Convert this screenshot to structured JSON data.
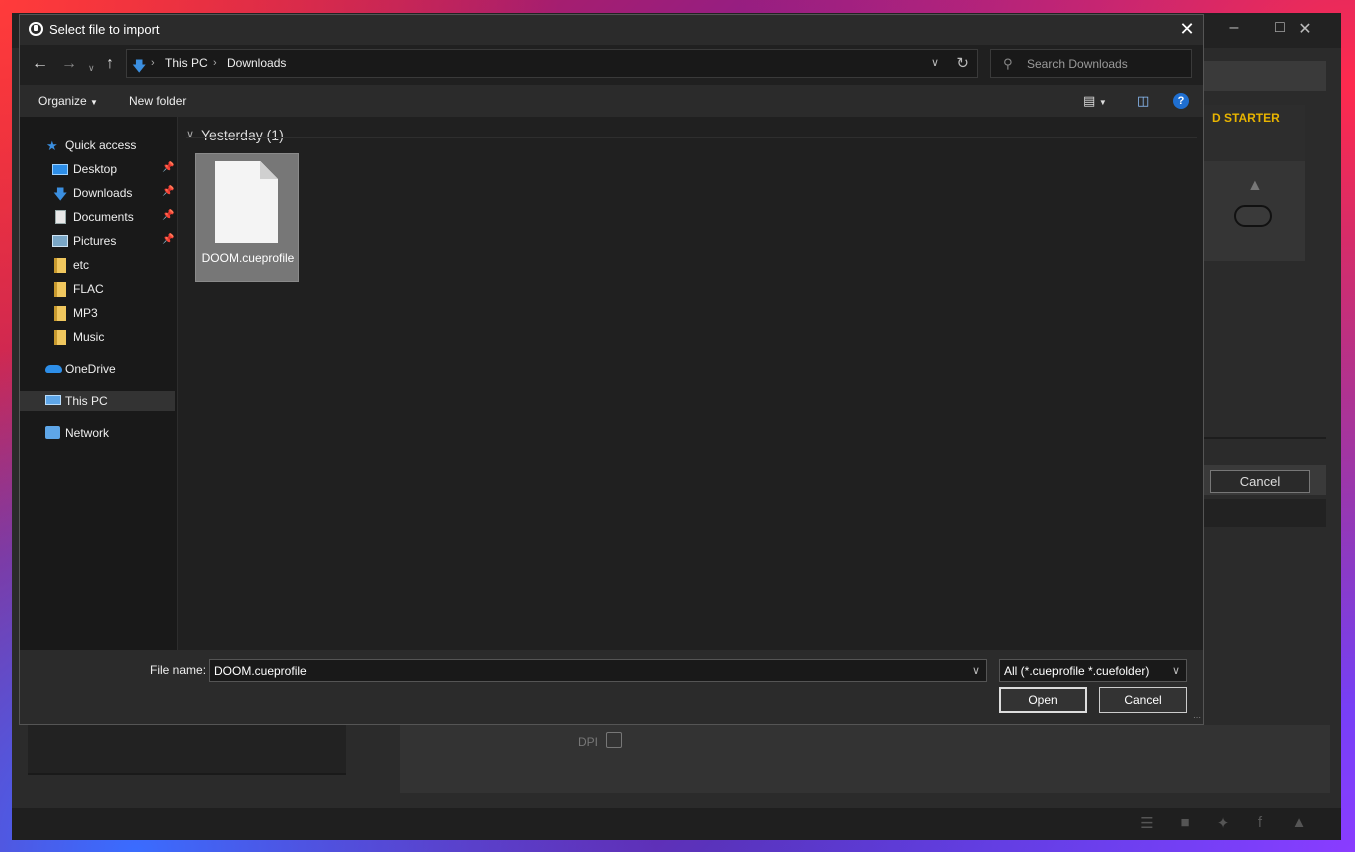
{
  "background_app": {
    "card_title": "D STARTER",
    "cancel_label": "Cancel",
    "dpi_label": "DPI"
  },
  "dialog": {
    "title": "Select file to import",
    "breadcrumb": [
      "This PC",
      "Downloads"
    ],
    "search_placeholder": "Search Downloads",
    "toolbar": {
      "organize_label": "Organize",
      "new_folder_label": "New folder"
    },
    "sidebar": {
      "quick_access": "Quick access",
      "items": [
        {
          "label": "Desktop",
          "icon": "desktop-icon",
          "pinned": true
        },
        {
          "label": "Downloads",
          "icon": "downloads-icon",
          "pinned": true
        },
        {
          "label": "Documents",
          "icon": "documents-icon",
          "pinned": true
        },
        {
          "label": "Pictures",
          "icon": "pictures-icon",
          "pinned": true
        },
        {
          "label": "etc",
          "icon": "folder-icon",
          "pinned": false
        },
        {
          "label": "FLAC",
          "icon": "folder-icon",
          "pinned": false
        },
        {
          "label": "MP3",
          "icon": "folder-icon",
          "pinned": false
        },
        {
          "label": "Music",
          "icon": "folder-icon",
          "pinned": false
        }
      ],
      "onedrive": "OneDrive",
      "this_pc": "This PC",
      "network": "Network"
    },
    "content": {
      "group_header": "Yesterday (1)",
      "files": [
        {
          "name": "DOOM.cueprofile",
          "icon": "file-icon",
          "selected": true
        }
      ]
    },
    "footer": {
      "file_name_label": "File name:",
      "file_name_value": "DOOM.cueprofile",
      "filter_value": "All (*.cueprofile *.cuefolder)",
      "open_label": "Open",
      "cancel_label": "Cancel"
    }
  },
  "colors": {
    "dialog_bg": "#202020",
    "accent_blue": "#3b8fe0",
    "folder_yellow": "#f0c75e",
    "brand_yellow": "#e8b400"
  }
}
